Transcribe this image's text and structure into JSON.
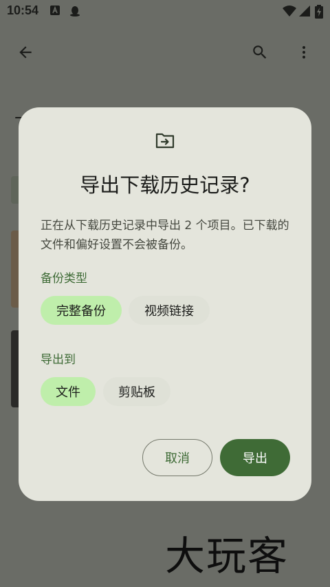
{
  "status_bar": {
    "time": "10:54",
    "icons": [
      "notification-a-icon",
      "notification-qq-icon",
      "wifi-icon",
      "signal-icon",
      "battery-charging-icon"
    ]
  },
  "app_bar": {
    "icons": [
      "back-arrow-icon",
      "search-icon",
      "more-vert-icon"
    ]
  },
  "dialog": {
    "icon": "folder-export-icon",
    "title": "导出下载历史记录?",
    "body": "正在从下载历史记录中导出 2 个项目。已下载的文件和偏好设置不会被备份。",
    "backup_type": {
      "label": "备份类型",
      "options": [
        {
          "label": "完整备份",
          "selected": true
        },
        {
          "label": "视频链接",
          "selected": false
        }
      ]
    },
    "export_to": {
      "label": "导出到",
      "options": [
        {
          "label": "文件",
          "selected": true
        },
        {
          "label": "剪贴板",
          "selected": false
        }
      ]
    },
    "cancel_label": "取消",
    "export_label": "导出"
  },
  "colors": {
    "scrim": "#6a6c66",
    "dialog_bg": "#e4e5dc",
    "accent": "#3f6b36",
    "chip_selected": "#bfeeab",
    "chip_unselected": "#dfe1d7"
  },
  "watermark": "大玩客"
}
